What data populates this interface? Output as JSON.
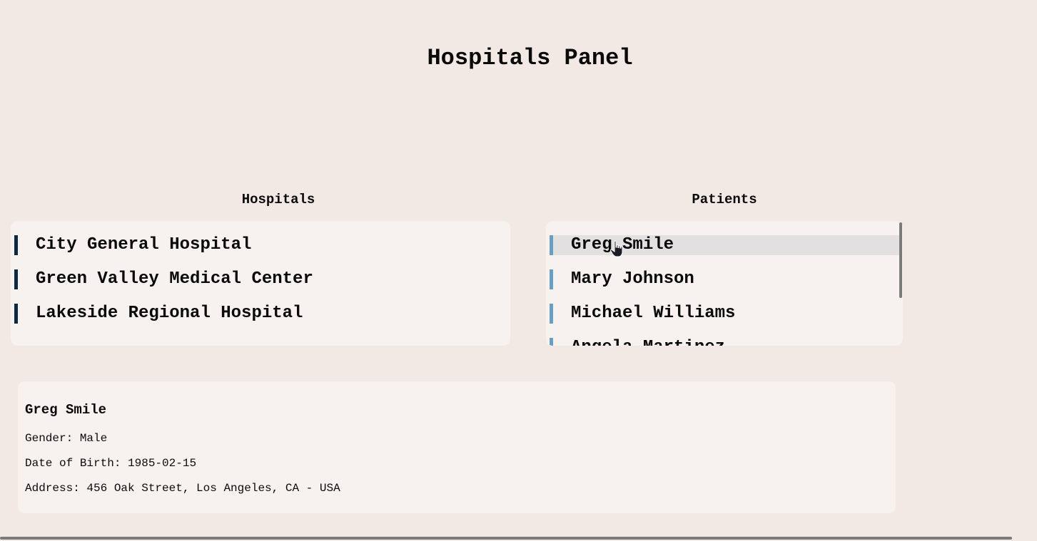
{
  "page": {
    "title": "Hospitals Panel"
  },
  "hospitals": {
    "heading": "Hospitals",
    "items": [
      "City General Hospital",
      "Green Valley Medical Center",
      "Lakeside Regional Hospital"
    ]
  },
  "patients": {
    "heading": "Patients",
    "items": [
      "Greg Smile",
      "Mary Johnson",
      "Michael Williams",
      "Angela Martinez"
    ],
    "selected": "Greg Smile"
  },
  "details": {
    "name": "Greg Smile",
    "gender": "Gender: Male",
    "dob": "Date of Birth: 1985-02-15",
    "address": "Address: 456 Oak Street, Los Angeles, CA - USA"
  },
  "colors": {
    "background": "#f2e9e5",
    "panel": "#f7f2f0",
    "hospital_accent": "#0e2a42",
    "patient_accent": "#6a9ec0",
    "selected_row": "#e2e0e0"
  },
  "icons": {
    "cursor": "hand-pointer-icon"
  }
}
